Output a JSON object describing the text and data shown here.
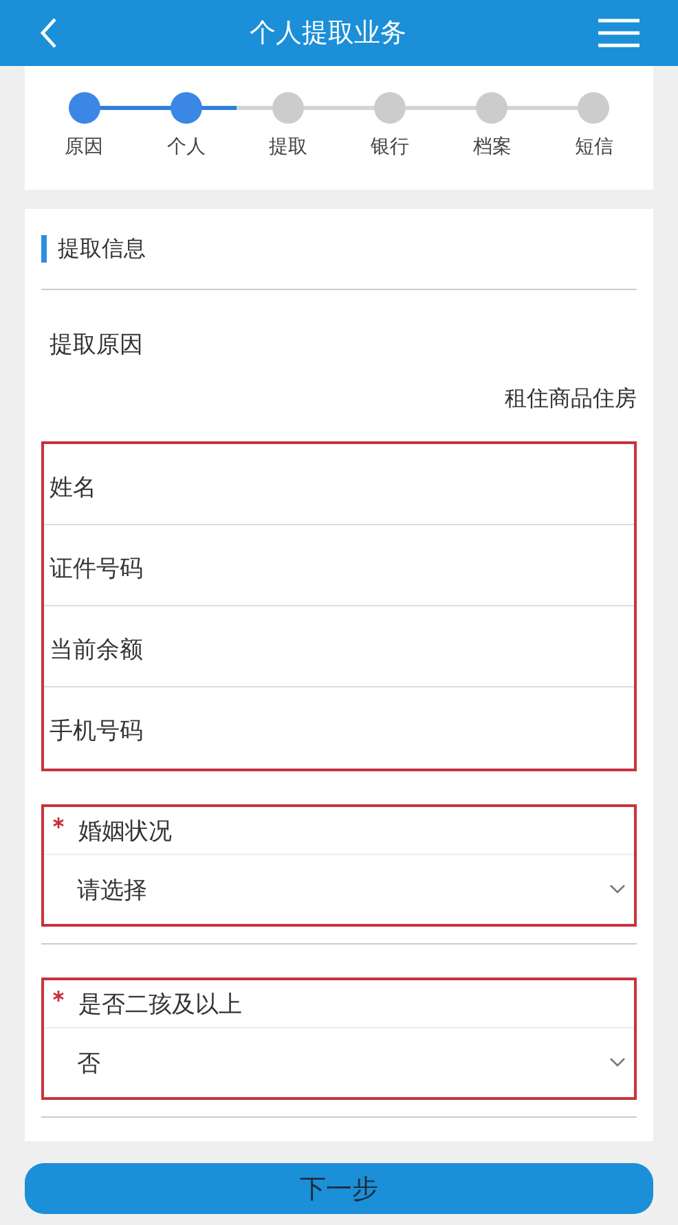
{
  "header": {
    "title": "个人提取业务"
  },
  "steps": [
    {
      "label": "原因",
      "done": true
    },
    {
      "label": "个人",
      "done": true
    },
    {
      "label": "提取",
      "done": false
    },
    {
      "label": "银行",
      "done": false
    },
    {
      "label": "档案",
      "done": false
    },
    {
      "label": "短信",
      "done": false
    }
  ],
  "section": {
    "title": "提取信息",
    "reason_label": "提取原因",
    "reason_value": "租住商品住房"
  },
  "field_group": {
    "highlighted": true,
    "fields": [
      {
        "label": "姓名"
      },
      {
        "label": "证件号码"
      },
      {
        "label": "当前余额"
      },
      {
        "label": "手机号码"
      }
    ]
  },
  "selects": [
    {
      "label": "婚姻状况",
      "required": true,
      "value": "请选择",
      "highlighted": true
    },
    {
      "label": "是否二孩及以上",
      "required": true,
      "value": "否",
      "highlighted": true
    }
  ],
  "next_button": "下一步"
}
